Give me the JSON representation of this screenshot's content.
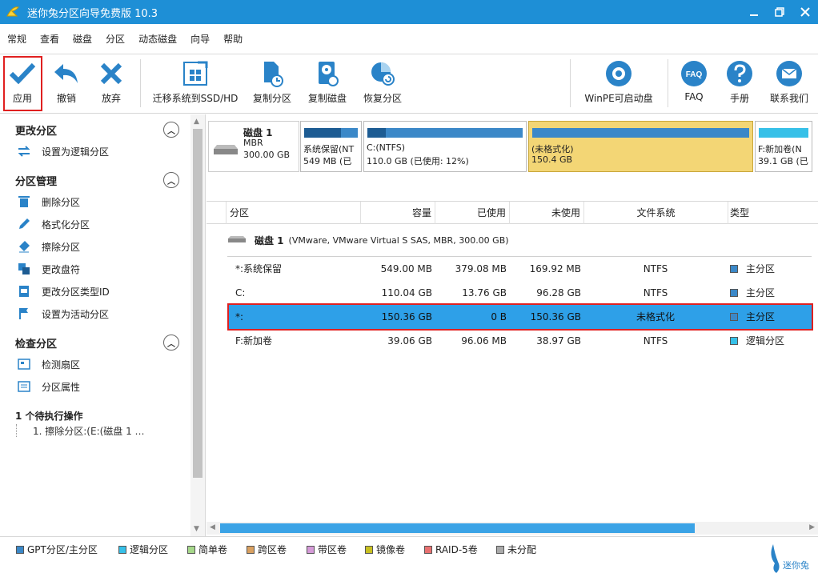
{
  "window": {
    "title": "迷你兔分区向导免费版 10.3",
    "colors": {
      "titlebar": "#1e8fd6",
      "accent": "#2ea0e8",
      "selection_outline": "#e02020"
    }
  },
  "menu": [
    "常规",
    "查看",
    "磁盘",
    "分区",
    "动态磁盘",
    "向导",
    "帮助"
  ],
  "toolbar": {
    "apply": "应用",
    "undo": "撤销",
    "discard": "放弃",
    "migrate": "迁移系统到SSD/HD",
    "copy_partition": "复制分区",
    "copy_disk": "复制磁盘",
    "recover_partition": "恢复分区",
    "winpe": "WinPE可启动盘",
    "faq": "FAQ",
    "manual": "手册",
    "contact": "联系我们",
    "faq_icon_text": "FAQ"
  },
  "left": {
    "sections": [
      {
        "title": "更改分区",
        "items": [
          "设置为逻辑分区"
        ]
      },
      {
        "title": "分区管理",
        "items": [
          "删除分区",
          "格式化分区",
          "擦除分区",
          "更改盘符",
          "更改分区类型ID",
          "设置为活动分区"
        ]
      },
      {
        "title": "检查分区",
        "items": [
          "检测扇区",
          "分区属性"
        ]
      }
    ],
    "pending_title": "1 个待执行操作",
    "pending_items": [
      "1. 擦除分区:(E:(磁盘 1 …"
    ]
  },
  "diskmap": {
    "disk": {
      "name": "磁盘 1",
      "type": "MBR",
      "size": "300.00 GB"
    },
    "partitions": [
      {
        "name": "系统保留(NT",
        "size": "549 MB (已",
        "used_fraction": 0.69
      },
      {
        "name": "C:(NTFS)",
        "size": "110.0 GB (已使用: 12%)",
        "used_fraction": 0.12
      },
      {
        "name": "(未格式化)",
        "size": "150.4 GB",
        "used_fraction": 0
      },
      {
        "name": "F:新加卷(N",
        "size": "39.1 GB (已",
        "used_fraction": 0
      }
    ]
  },
  "table": {
    "headers": [
      "分区",
      "容量",
      "已使用",
      "未使用",
      "文件系统",
      "类型"
    ],
    "disk_row": {
      "name": "磁盘 1",
      "desc": "(VMware, VMware Virtual S SAS, MBR, 300.00 GB)"
    },
    "rows": [
      {
        "partition": "*:系统保留",
        "capacity": "549.00 MB",
        "used": "379.08 MB",
        "unused": "169.92 MB",
        "fs": "NTFS",
        "type": "主分区",
        "type_color": "#3b88c8"
      },
      {
        "partition": "C:",
        "capacity": "110.04 GB",
        "used": "13.76 GB",
        "unused": "96.28 GB",
        "fs": "NTFS",
        "type": "主分区",
        "type_color": "#3b88c8"
      },
      {
        "partition": "*:",
        "capacity": "150.36 GB",
        "used": "0 B",
        "unused": "150.36 GB",
        "fs": "未格式化",
        "type": "主分区",
        "type_color": "#3b88c8"
      },
      {
        "partition": "F:新加卷",
        "capacity": "39.06 GB",
        "used": "96.06 MB",
        "unused": "38.97 GB",
        "fs": "NTFS",
        "type": "逻辑分区",
        "type_color": "#36c0e8"
      }
    ]
  },
  "legend": [
    {
      "label": "GPT分区/主分区",
      "color": "#3b88c8"
    },
    {
      "label": "逻辑分区",
      "color": "#36c0e8"
    },
    {
      "label": "简单卷",
      "color": "#a6d88a"
    },
    {
      "label": "跨区卷",
      "color": "#d9a060"
    },
    {
      "label": "带区卷",
      "color": "#d59ad8"
    },
    {
      "label": "镜像卷",
      "color": "#c8c020"
    },
    {
      "label": "RAID-5卷",
      "color": "#e87070"
    },
    {
      "label": "未分配",
      "color": "#aaaaaa"
    }
  ],
  "brand": {
    "name": "迷你兔"
  }
}
